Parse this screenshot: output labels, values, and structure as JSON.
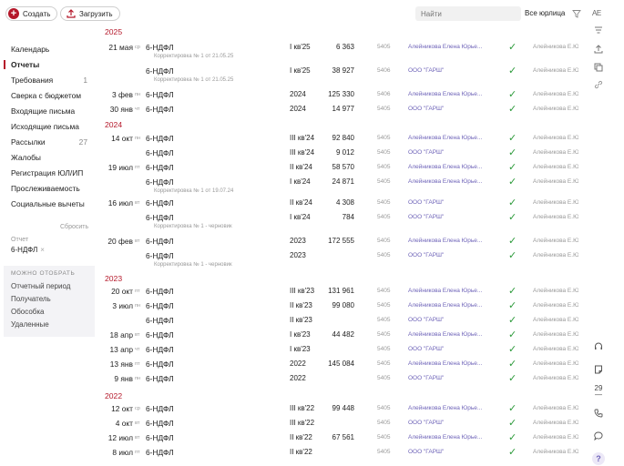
{
  "toolbar": {
    "create_label": "Создать",
    "upload_label": "Загрузить",
    "search_placeholder": "Найти",
    "org_select": "Все юрлица",
    "ae_label": "AE"
  },
  "sidebar": {
    "items": [
      {
        "label": "Календарь",
        "count": ""
      },
      {
        "label": "Отчеты",
        "count": ""
      },
      {
        "label": "Требования",
        "count": "1"
      },
      {
        "label": "Сверка с бюджетом",
        "count": ""
      },
      {
        "label": "Входящие письма",
        "count": ""
      },
      {
        "label": "Исходящие письма",
        "count": ""
      },
      {
        "label": "Рассылки",
        "count": "27"
      },
      {
        "label": "Жалобы",
        "count": ""
      },
      {
        "label": "Регистрация ЮЛ/ИП",
        "count": ""
      },
      {
        "label": "Прослеживаемость",
        "count": ""
      },
      {
        "label": "Социальные вычеты",
        "count": ""
      }
    ],
    "reset_label": "Сбросить",
    "filter_label": "Отчет",
    "filter_value": "6-НДФЛ",
    "more_title": "МОЖНО ОТОБРАТЬ",
    "more_items": [
      "Отчетный период",
      "Получатель",
      "Обособка",
      "Удаленные"
    ]
  },
  "years": [
    "2025",
    "2024",
    "2023",
    "2022"
  ],
  "rows": [
    {
      "day": "21 мая",
      "wd": "ср",
      "type": "6-НДФЛ",
      "correction": "Корректировка № 1 от 21.05.25",
      "period": "I кв'25",
      "amount": "6 363",
      "code": "5405",
      "recipient": "Алейникова Елена Юрье...",
      "resp": "Алейникова Е.Ю."
    },
    {
      "day": "",
      "wd": "",
      "type": "6-НДФЛ",
      "correction": "Корректировка № 1 от 21.05.25",
      "period": "I кв'25",
      "amount": "38 927",
      "code": "5406",
      "recipient": "ООО \"ГАРШ\"",
      "resp": "Алейникова Е.Ю."
    },
    {
      "day": "3 фев",
      "wd": "пн",
      "type": "6-НДФЛ",
      "correction": "",
      "period": "2024",
      "amount": "125 330",
      "code": "5406",
      "recipient": "Алейникова Елена Юрье...",
      "resp": "Алейникова Е.Ю."
    },
    {
      "day": "30 янв",
      "wd": "чт",
      "type": "6-НДФЛ",
      "correction": "",
      "period": "2024",
      "amount": "14 977",
      "code": "5405",
      "recipient": "ООО \"ГАРШ\"",
      "resp": "Алейникова Е.Ю."
    },
    {
      "day": "14 окт",
      "wd": "пн",
      "type": "6-НДФЛ",
      "correction": "",
      "period": "III кв'24",
      "amount": "92 840",
      "code": "5405",
      "recipient": "Алейникова Елена Юрье...",
      "resp": "Алейникова Е.Ю."
    },
    {
      "day": "",
      "wd": "",
      "type": "6-НДФЛ",
      "correction": "",
      "period": "III кв'24",
      "amount": "9 012",
      "code": "5405",
      "recipient": "ООО \"ГАРШ\"",
      "resp": "Алейникова Е.Ю."
    },
    {
      "day": "19 июл",
      "wd": "пт",
      "type": "6-НДФЛ",
      "correction": "",
      "period": "II кв'24",
      "amount": "58 570",
      "code": "5405",
      "recipient": "Алейникова Елена Юрье...",
      "resp": "Алейникова Е.Ю."
    },
    {
      "day": "",
      "wd": "",
      "type": "6-НДФЛ",
      "correction": "Корректировка № 1 от 19.07.24",
      "period": "I кв'24",
      "amount": "24 871",
      "code": "5405",
      "recipient": "Алейникова Елена Юрье...",
      "resp": "Алейникова Е.Ю."
    },
    {
      "day": "16 июл",
      "wd": "вт",
      "type": "6-НДФЛ",
      "correction": "",
      "period": "II кв'24",
      "amount": "4 308",
      "code": "5405",
      "recipient": "ООО \"ГАРШ\"",
      "resp": "Алейникова Е.Ю."
    },
    {
      "day": "",
      "wd": "",
      "type": "6-НДФЛ",
      "correction": "Корректировка № 1 - черновик",
      "period": "I кв'24",
      "amount": "784",
      "code": "5405",
      "recipient": "ООО \"ГАРШ\"",
      "resp": "Алейникова Е.Ю."
    },
    {
      "day": "20 фев",
      "wd": "вт",
      "type": "6-НДФЛ",
      "correction": "",
      "period": "2023",
      "amount": "172 555",
      "code": "5405",
      "recipient": "Алейникова Елена Юрье...",
      "resp": "Алейникова Е.Ю."
    },
    {
      "day": "",
      "wd": "",
      "type": "6-НДФЛ",
      "correction": "Корректировка № 1 - черновик",
      "period": "2023",
      "amount": "",
      "code": "5405",
      "recipient": "ООО \"ГАРШ\"",
      "resp": "Алейникова Е.Ю."
    },
    {
      "day": "20 окт",
      "wd": "пт",
      "type": "6-НДФЛ",
      "correction": "",
      "period": "III кв'23",
      "amount": "131 961",
      "code": "5405",
      "recipient": "Алейникова Елена Юрье...",
      "resp": "Алейникова Е.Ю."
    },
    {
      "day": "3 июл",
      "wd": "пн",
      "type": "6-НДФЛ",
      "correction": "",
      "period": "II кв'23",
      "amount": "99 080",
      "code": "5405",
      "recipient": "Алейникова Елена Юрье...",
      "resp": "Алейникова Е.Ю."
    },
    {
      "day": "",
      "wd": "",
      "type": "6-НДФЛ",
      "correction": "",
      "period": "II кв'23",
      "amount": "",
      "code": "5405",
      "recipient": "ООО \"ГАРШ\"",
      "resp": "Алейникова Е.Ю."
    },
    {
      "day": "18 апр",
      "wd": "вт",
      "type": "6-НДФЛ",
      "correction": "",
      "period": "I кв'23",
      "amount": "44 482",
      "code": "5405",
      "recipient": "Алейникова Елена Юрье...",
      "resp": "Алейникова Е.Ю."
    },
    {
      "day": "13 апр",
      "wd": "чт",
      "type": "6-НДФЛ",
      "correction": "",
      "period": "I кв'23",
      "amount": "",
      "code": "5405",
      "recipient": "ООО \"ГАРШ\"",
      "resp": "Алейникова Е.Ю."
    },
    {
      "day": "13 янв",
      "wd": "пт",
      "type": "6-НДФЛ",
      "correction": "",
      "period": "2022",
      "amount": "145 084",
      "code": "5405",
      "recipient": "Алейникова Елена Юрье...",
      "resp": "Алейникова Е.Ю."
    },
    {
      "day": "9 янв",
      "wd": "пн",
      "type": "6-НДФЛ",
      "correction": "",
      "period": "2022",
      "amount": "",
      "code": "5405",
      "recipient": "ООО \"ГАРШ\"",
      "resp": "Алейникова Е.Ю."
    },
    {
      "day": "12 окт",
      "wd": "ср",
      "type": "6-НДФЛ",
      "correction": "",
      "period": "III кв'22",
      "amount": "99 448",
      "code": "5405",
      "recipient": "Алейникова Елена Юрье...",
      "resp": "Алейникова Е.Ю."
    },
    {
      "day": "4 окт",
      "wd": "вт",
      "type": "6-НДФЛ",
      "correction": "",
      "period": "III кв'22",
      "amount": "",
      "code": "5405",
      "recipient": "ООО \"ГАРШ\"",
      "resp": "Алейникова Е.Ю."
    },
    {
      "day": "12 июл",
      "wd": "вт",
      "type": "6-НДФЛ",
      "correction": "",
      "period": "II кв'22",
      "amount": "67 561",
      "code": "5405",
      "recipient": "Алейникова Елена Юрье...",
      "resp": "Алейникова Е.Ю."
    },
    {
      "day": "8 июл",
      "wd": "пт",
      "type": "6-НДФЛ",
      "correction": "",
      "period": "II кв'22",
      "amount": "",
      "code": "5405",
      "recipient": "ООО \"ГАРШ\"",
      "resp": "Алейникова Е.Ю."
    }
  ],
  "rightbar": {
    "calendar_day": "29"
  },
  "colors": {
    "accent": "#b5182a",
    "link": "#6e63b8",
    "ok": "#2c9a3a"
  }
}
